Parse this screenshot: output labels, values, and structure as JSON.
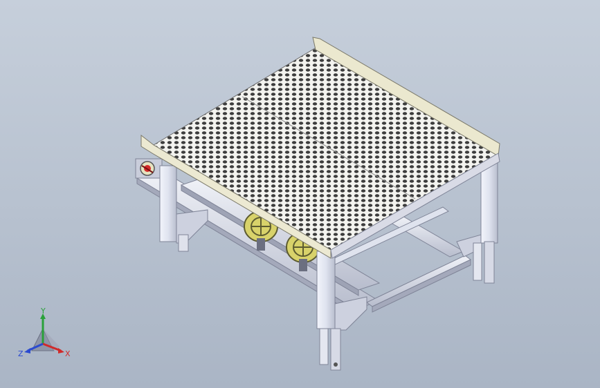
{
  "viewport": {
    "background_top": "#c6cfdb",
    "background_bottom": "#aab5c5"
  },
  "model": {
    "colors": {
      "deck": "#f4f4ee",
      "deck_edge": "#e9e6cf",
      "perforation": "#3a3a3a",
      "frame_light": "#e9ecf5",
      "frame_mid": "#c8ccdc",
      "frame_dark": "#8f94a8",
      "wheel": "#d8d26a",
      "wheel_dark": "#6b6a3a",
      "handwheel_red": "#d42a2a"
    },
    "icons": [
      "perforated-deck",
      "guide-wheel",
      "handwheel-icon"
    ]
  },
  "triad": {
    "y_label": "Y",
    "x_label": "X",
    "z_label": "Z",
    "colors": {
      "y": "#2aa13a",
      "x": "#d02a2a",
      "z": "#2a4ad0"
    }
  }
}
